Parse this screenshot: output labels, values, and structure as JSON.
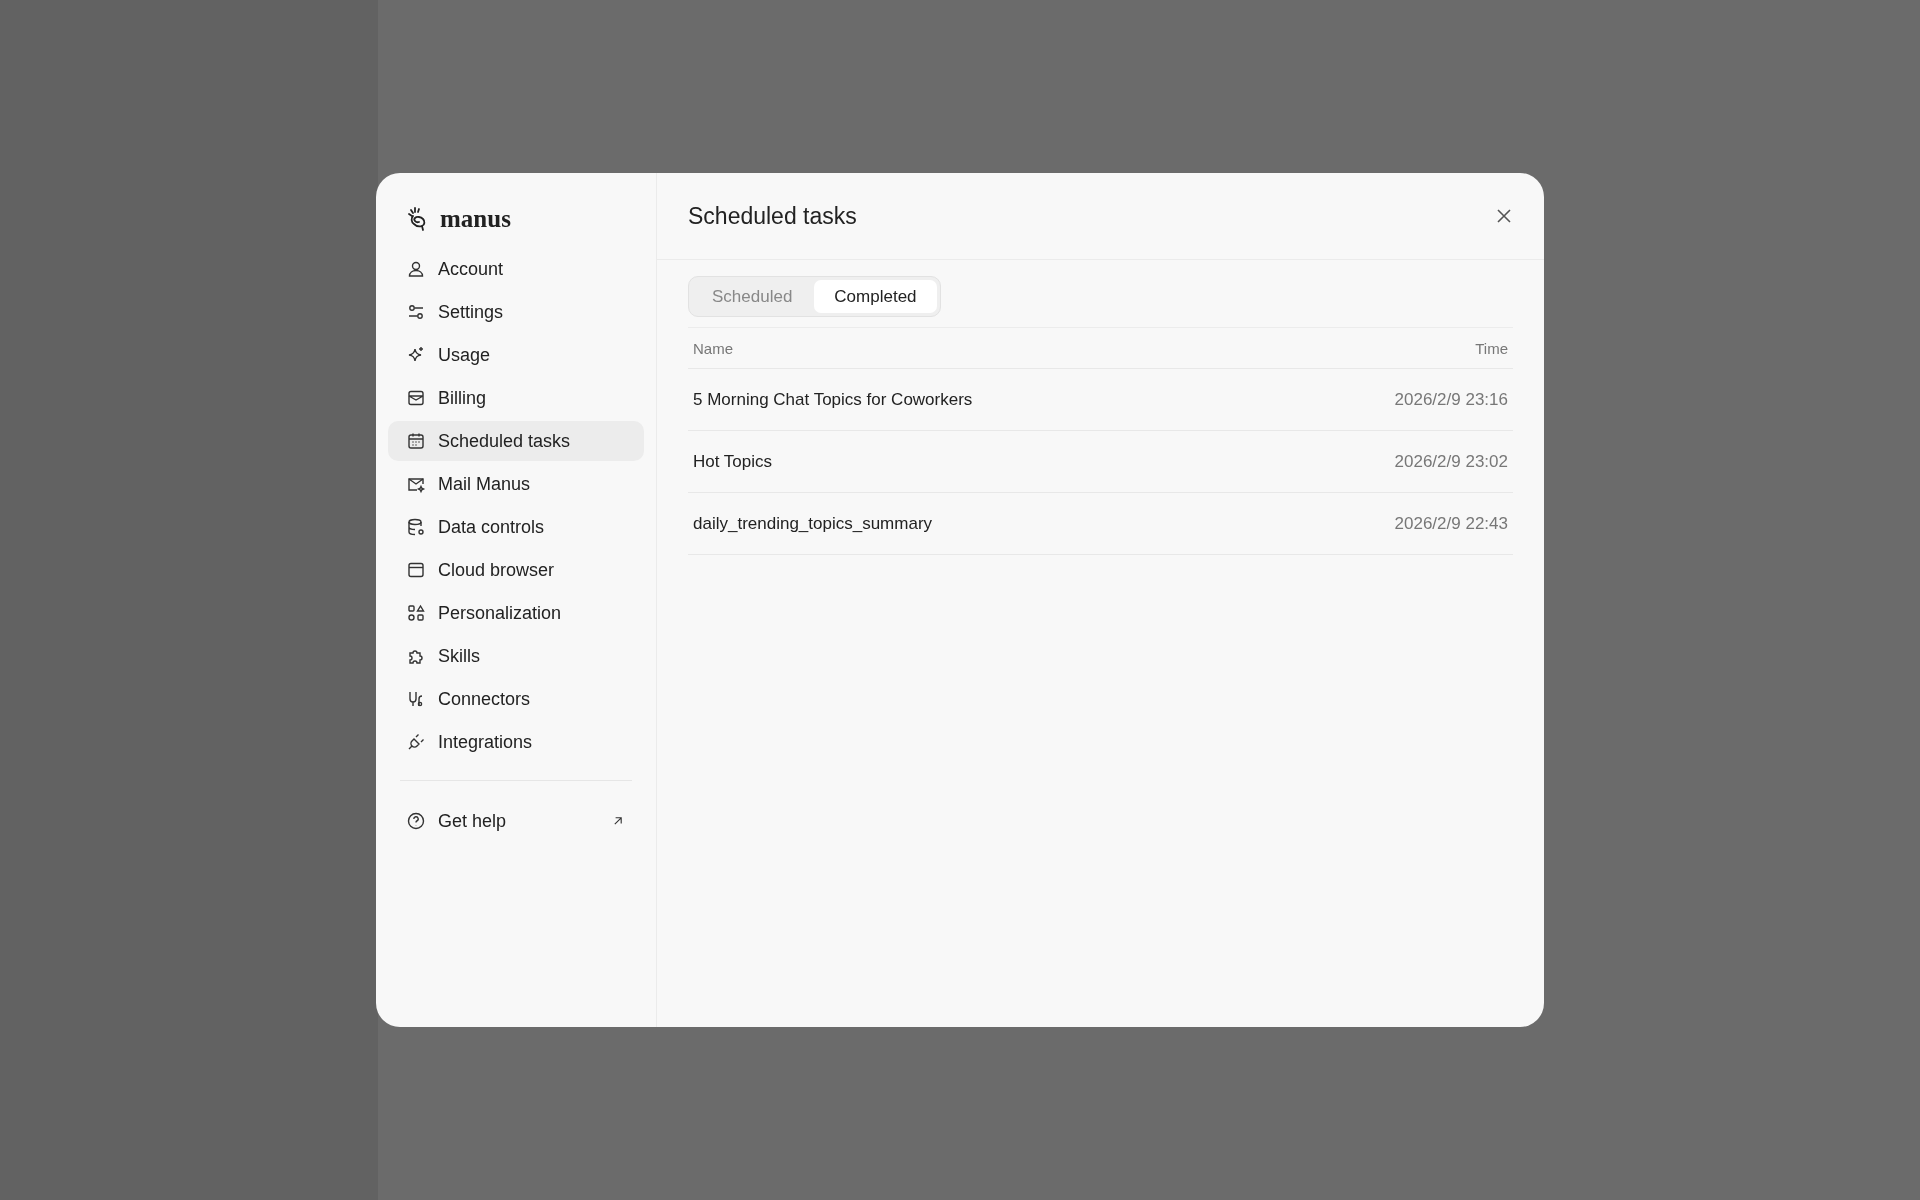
{
  "brand": "manus",
  "nav": [
    {
      "kind": "person",
      "label": "Account",
      "selected": false
    },
    {
      "kind": "sliders",
      "label": "Settings",
      "selected": false
    },
    {
      "kind": "sparkle",
      "label": "Usage",
      "selected": false
    },
    {
      "kind": "billing",
      "label": "Billing",
      "selected": false
    },
    {
      "kind": "calendar",
      "label": "Scheduled tasks",
      "selected": true
    },
    {
      "kind": "mail",
      "label": "Mail Manus",
      "selected": false
    },
    {
      "kind": "database",
      "label": "Data controls",
      "selected": false
    },
    {
      "kind": "browser",
      "label": "Cloud browser",
      "selected": false
    },
    {
      "kind": "shapes",
      "label": "Personalization",
      "selected": false
    },
    {
      "kind": "puzzle",
      "label": "Skills",
      "selected": false
    },
    {
      "kind": "connectors",
      "label": "Connectors",
      "selected": false
    },
    {
      "kind": "plug",
      "label": "Integrations",
      "selected": false
    }
  ],
  "help": {
    "label": "Get help"
  },
  "panel": {
    "title": "Scheduled tasks",
    "tabs": [
      {
        "label": "Scheduled",
        "selected": false
      },
      {
        "label": "Completed",
        "selected": true
      }
    ],
    "columns": [
      "Name",
      "Time"
    ],
    "rows": [
      {
        "name": "5 Morning Chat Topics for Coworkers",
        "time": "2026/2/9 23:16"
      },
      {
        "name": "Hot Topics",
        "time": "2026/2/9 23:02"
      },
      {
        "name": "daily_trending_topics_summary",
        "time": "2026/2/9 22:43"
      }
    ]
  }
}
